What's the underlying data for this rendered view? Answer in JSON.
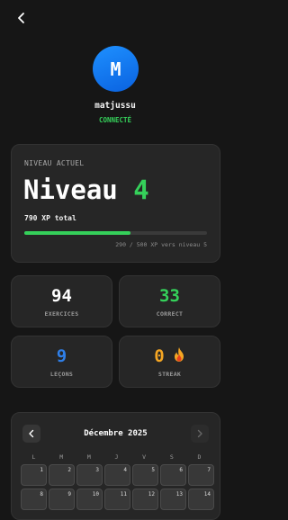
{
  "header": {
    "back_icon": "chevron-left-icon"
  },
  "profile": {
    "initial": "M",
    "username": "matjussu",
    "status": "CONNECTÉ",
    "avatar_color": "#1e7cf0",
    "status_color": "#35d05a"
  },
  "level": {
    "label": "NIVEAU ACTUEL",
    "title_word": "Niveau",
    "number": "4",
    "xp_total": "790 XP total",
    "progress_fraction": 0.58,
    "xp_next": "290 / 500 XP vers niveau 5"
  },
  "stats": [
    {
      "value": "94",
      "label": "EXERCICES",
      "color": "#ffffff"
    },
    {
      "value": "33",
      "label": "CORRECT",
      "color": "#35d05a"
    },
    {
      "value": "9",
      "label": "LEÇONS",
      "color": "#2f7fe8"
    },
    {
      "value": "0",
      "label": "STREAK",
      "color": "#f5a623"
    }
  ],
  "calendar": {
    "title": "Décembre 2025",
    "prev_icon": "chevron-left-icon",
    "next_icon": "chevron-right-icon",
    "weekdays": [
      "L",
      "M",
      "M",
      "J",
      "V",
      "S",
      "D"
    ],
    "days": [
      "1",
      "2",
      "3",
      "4",
      "5",
      "6",
      "7",
      "8",
      "9",
      "10",
      "11",
      "12",
      "13",
      "14"
    ]
  }
}
